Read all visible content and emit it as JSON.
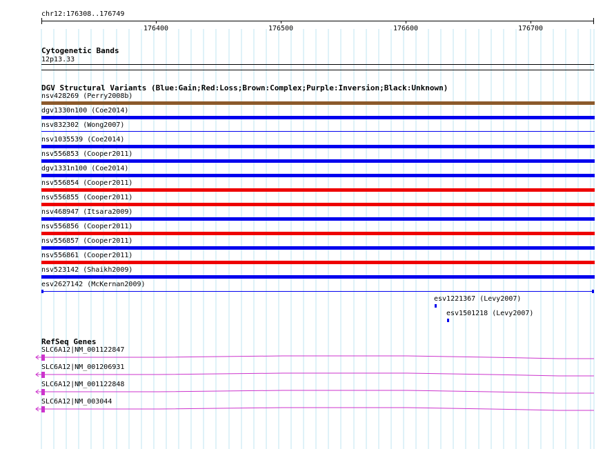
{
  "ruler": {
    "coordinate_label": "chr12:176308..176749",
    "ticks": [
      "176400",
      "176500",
      "176600",
      "176700"
    ]
  },
  "cytoband": {
    "title": "Cytogenetic Bands",
    "band": "12p13.33"
  },
  "dgv": {
    "title": "DGV Structural Variants (Blue:Gain;Red:Loss;Brown:Complex;Purple:Inversion;Black:Unknown)",
    "variants": [
      {
        "label": "nsv428269 (Perry2008b)",
        "color": "#8b5a2b"
      },
      {
        "label": "dgv1330n100 (Coe2014)",
        "color": "#0000ee"
      },
      {
        "label": "nsv832302 (Wong2007)",
        "color": "#0000ee"
      },
      {
        "label": "nsv1035539 (Coe2014)",
        "color": "#0000ee"
      },
      {
        "label": "nsv556853 (Cooper2011)",
        "color": "#0000ee"
      },
      {
        "label": "dgv1331n100 (Coe2014)",
        "color": "#0000ee"
      },
      {
        "label": "nsv556854 (Cooper2011)",
        "color": "#ee0000"
      },
      {
        "label": "nsv556855 (Cooper2011)",
        "color": "#ee0000"
      },
      {
        "label": "nsv468947 (Itsara2009)",
        "color": "#0000ee"
      },
      {
        "label": "nsv556856 (Cooper2011)",
        "color": "#ee0000"
      },
      {
        "label": "nsv556857 (Cooper2011)",
        "color": "#0000ee"
      },
      {
        "label": "nsv556861 (Cooper2011)",
        "color": "#ee0000"
      },
      {
        "label": "nsv523142 (Shaikh2009)",
        "color": "#0000ee"
      },
      {
        "label": "esv2627142 (McKernan2009)",
        "color": "#0000ee"
      }
    ],
    "small_variants": [
      {
        "label": "esv1221367 (Levy2007)",
        "color": "#0000ee"
      },
      {
        "label": "esv1501218 (Levy2007)",
        "color": "#0000ee"
      }
    ]
  },
  "refseq": {
    "title": "RefSeq Genes",
    "genes": [
      {
        "label": "SLC6A12|NM_001122847"
      },
      {
        "label": "SLC6A12|NM_001206931"
      },
      {
        "label": "SLC6A12|NM_001122848"
      },
      {
        "label": "SLC6A12|NM_003044"
      }
    ],
    "color": "#cc33cc"
  },
  "colors": {
    "grid": "#bfe6f0",
    "gain": "#0000ee",
    "loss": "#ee0000",
    "complex": "#8b5a2b",
    "gene": "#cc33cc"
  }
}
